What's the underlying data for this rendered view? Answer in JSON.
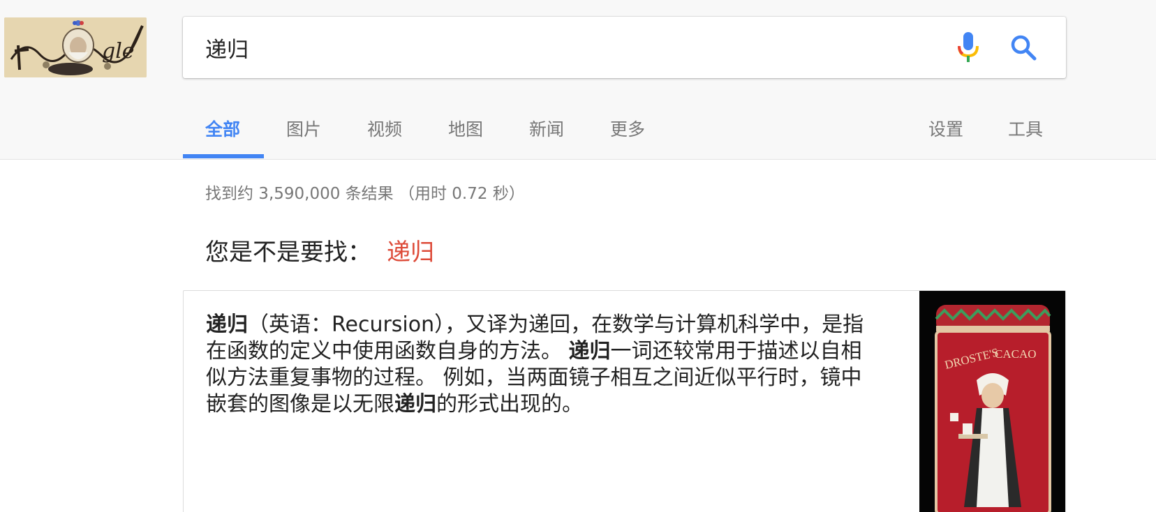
{
  "search": {
    "query": "递归"
  },
  "tabs": [
    {
      "label": "全部",
      "active": true
    },
    {
      "label": "图片"
    },
    {
      "label": "视频"
    },
    {
      "label": "地图"
    },
    {
      "label": "新闻"
    },
    {
      "label": "更多"
    },
    {
      "label": "设置"
    },
    {
      "label": "工具"
    }
  ],
  "results": {
    "stats": "找到约 3,590,000 条结果 （用时 0.72 秒）",
    "did_you_mean_label": "您是不是要找：",
    "did_you_mean_term": "递归"
  },
  "snippet": {
    "parts": [
      "递归",
      "（英语：Recursion），又译为递回，在数学与计算机科学中，是指在函数的定义中使用函数自身的方法。 ",
      "递归",
      "一词还较常用于描述以自相似方法重复事物的过程。 例如，当两面镜子相互之间近似平行时，镜中嵌套的图像是以无限",
      "递归",
      "的形式出现的。"
    ]
  },
  "card_image": {
    "brand_line1": "DROSTE'S",
    "brand_line2": "CACAO"
  },
  "colors": {
    "accent_blue": "#4285f4",
    "suggest_red": "#dd4b39",
    "text_gray": "#777777"
  },
  "icons": {
    "mic": "microphone-icon",
    "search": "search-icon"
  }
}
